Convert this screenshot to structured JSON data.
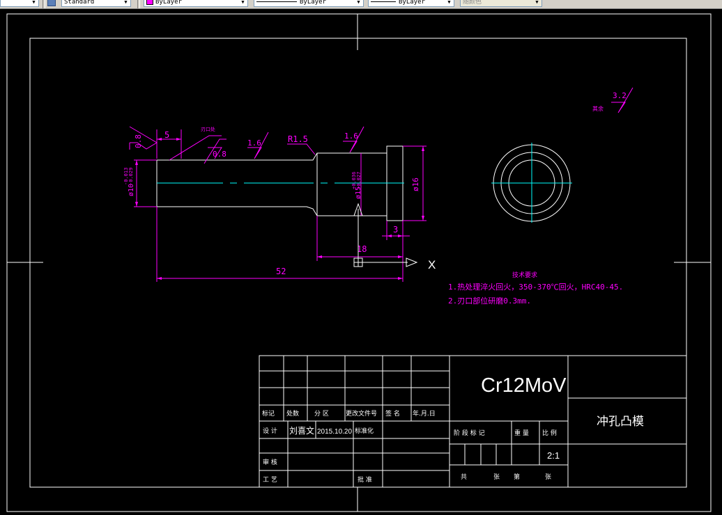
{
  "toolbar": {
    "text_style": "Standard",
    "color_control": "ByLayer",
    "linetype_control": "ByLayer",
    "lineweight_control": "ByLayer",
    "plotstyle_control": "随颜色",
    "colors": {
      "bylayer_swatch": "#ff00ff",
      "background": "#d4d0c8"
    }
  },
  "drawing": {
    "colors": {
      "canvas": "#000000",
      "geometry": "#ffffff",
      "dimensions": "#ff00ff",
      "centerline": "#00ffff"
    },
    "dimensions": {
      "d_5": "5",
      "d_18": "18",
      "d_52": "52",
      "d_3": "3",
      "dia_16": "ø16",
      "dia_shank": "ø10",
      "dia_shank_tol_upper": "-0.013",
      "dia_shank_tol_lower": "-0.029",
      "dia_mid": "ø15",
      "dia_mid_tol_upper": "+0.036",
      "dia_mid_tol_lower": "+0.027",
      "radius": "R1.5",
      "rough_08_left": "0.8",
      "rough_08_mid": "0.8",
      "rough_16_a": "1.6",
      "rough_16_b": "1.6",
      "rough_other": "3.2",
      "rough_other_label": "其余",
      "cut_edge_label": "刃口处"
    },
    "ucs": {
      "x_label": "X"
    },
    "tech_requirements": {
      "title": "技术要求",
      "line1": "1.热处理淬火回火，350-370℃回火，HRC40-45.",
      "line2": "2.刃口部位研磨0.3mm."
    }
  },
  "title_block": {
    "material": "Cr12MoV",
    "part_name": "冲孔凸模",
    "scale": "2:1",
    "rev_headers": [
      "标记",
      "处数",
      "分 区",
      "更改文件号",
      "签 名",
      "年.月.日"
    ],
    "design_label": "设 计",
    "designer": "刘喜文",
    "design_date": "2015.10.20",
    "standardization_label": "标准化",
    "review_label": "审 核",
    "process_label": "工 艺",
    "approve_label": "批 准",
    "stage_mark_label": "阶 段 标 记",
    "weight_label": "重 量",
    "scale_label": "比 例",
    "sheet_total_label": "共",
    "sheet_total_unit": "张",
    "sheet_no_label": "第",
    "sheet_no_unit": "张"
  }
}
